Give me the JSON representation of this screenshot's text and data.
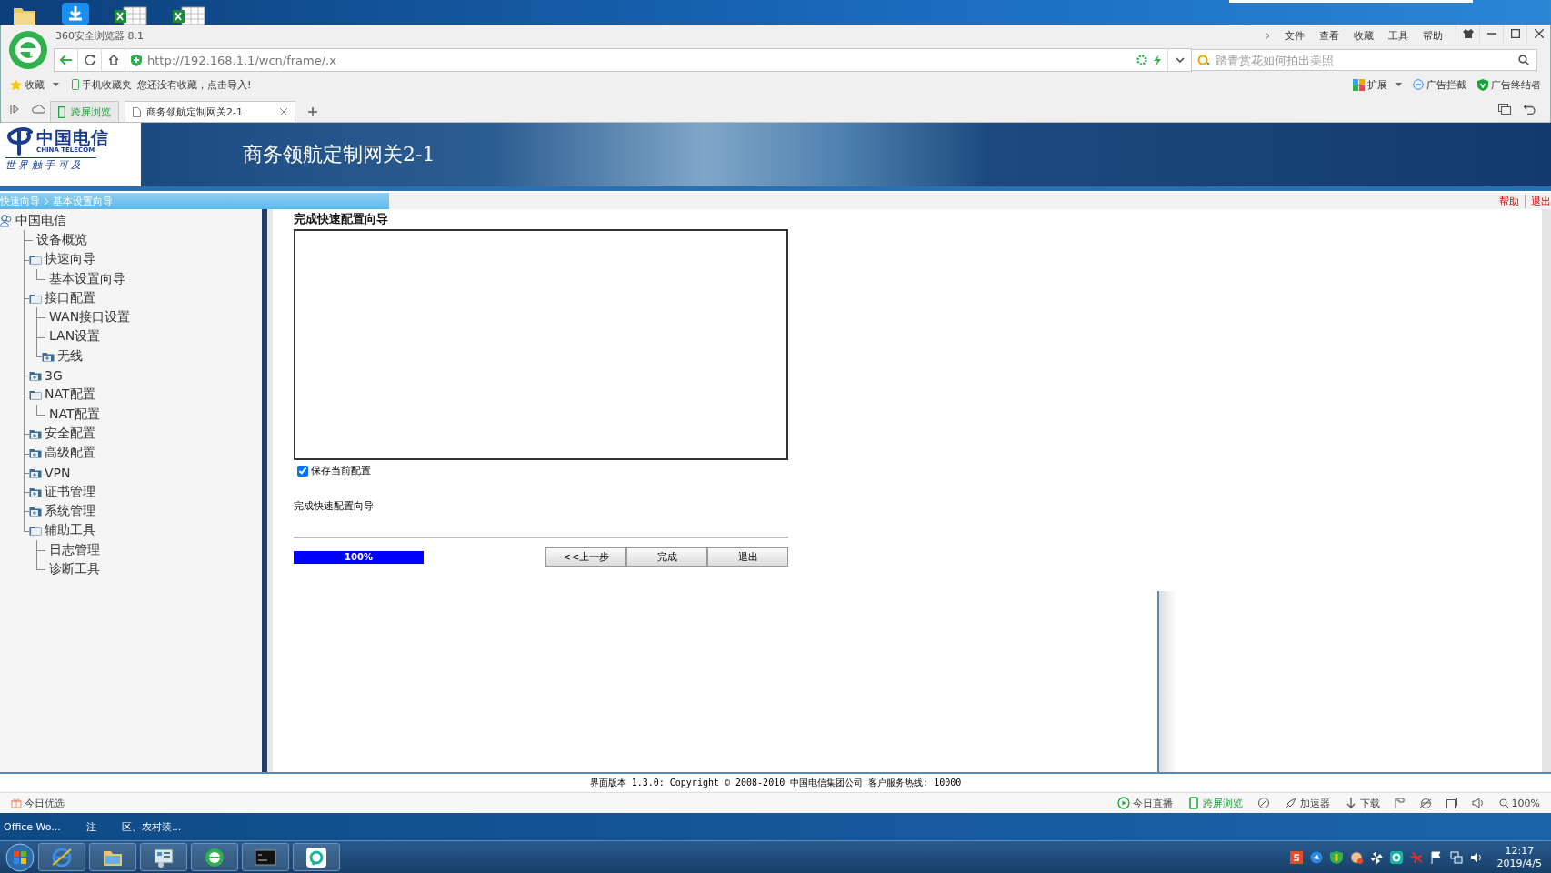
{
  "desktop": {
    "labels": [
      "Office Wo...",
      "注",
      "区、农村装..."
    ]
  },
  "browser": {
    "title": "360安全浏览器 8.1",
    "menu": [
      "文件",
      "查看",
      "收藏",
      "工具",
      "帮助"
    ],
    "url": "http://192.168.1.1/wcn/frame/.x",
    "search": {
      "placeholder": "踏青赏花如何拍出美照"
    },
    "bookmarks": {
      "favorites": "收藏",
      "mobile": "手机收藏夹",
      "hint": "您还没有收藏，点击导入!",
      "extensions": "扩展",
      "adblock": "广告拦截",
      "ad_terminator": "广告终结者"
    },
    "tabs": [
      {
        "label": "跨屏浏览",
        "kind": "feature",
        "selected": false
      },
      {
        "label": "商务领航定制网关2-1",
        "kind": "page",
        "selected": true
      }
    ]
  },
  "page": {
    "logo": {
      "name": "中国电信",
      "english": "CHINA TELECOM",
      "slogan": "世 界 触 手 可 及"
    },
    "header_title": "商务领航定制网关2-1",
    "breadcrumb": [
      "快速向导",
      "基本设置向导"
    ],
    "top_links": [
      "帮助",
      "退出"
    ],
    "tree": {
      "label": "中国电信",
      "children": [
        {
          "label": "设备概览"
        },
        {
          "label": "快速向导",
          "expanded": true,
          "children": [
            {
              "label": "基本设置向导"
            }
          ]
        },
        {
          "label": "接口配置",
          "expanded": true,
          "children": [
            {
              "label": "WAN接口设置"
            },
            {
              "label": "LAN设置"
            },
            {
              "label": "无线",
              "expanded": false
            }
          ]
        },
        {
          "label": "3G",
          "expanded": false
        },
        {
          "label": "NAT配置",
          "expanded": true,
          "children": [
            {
              "label": "NAT配置"
            }
          ]
        },
        {
          "label": "安全配置",
          "expanded": false
        },
        {
          "label": "高级配置",
          "expanded": false
        },
        {
          "label": "VPN",
          "expanded": false
        },
        {
          "label": "证书管理",
          "expanded": false
        },
        {
          "label": "系统管理",
          "expanded": false
        },
        {
          "label": "辅助工具",
          "expanded": true,
          "children": [
            {
              "label": "日志管理"
            },
            {
              "label": "诊断工具"
            }
          ]
        }
      ]
    },
    "wizard": {
      "title": "完成快速配置向导",
      "save": {
        "label": "保存当前配置",
        "checked": true
      },
      "message": "完成快速配置向导",
      "progress": {
        "level": 1,
        "label": "100%"
      },
      "buttons": [
        "<<上一步",
        "完成",
        "退出"
      ]
    },
    "footer": "界面版本 1.3.0: Copyright © 2008-2010 中国电信集团公司 客户服务热线: 10000"
  },
  "status_bar": {
    "left": "今日优选",
    "items": [
      {
        "label": "今日直播",
        "kind": "live"
      },
      {
        "label": "跨屏浏览",
        "kind": "phone"
      },
      {
        "label": "加速器",
        "kind": "rocket"
      },
      {
        "label": "下载",
        "kind": "download"
      }
    ],
    "zoom": "100%"
  },
  "taskbar": {
    "time": "12:17",
    "date": "2019/4/5"
  }
}
